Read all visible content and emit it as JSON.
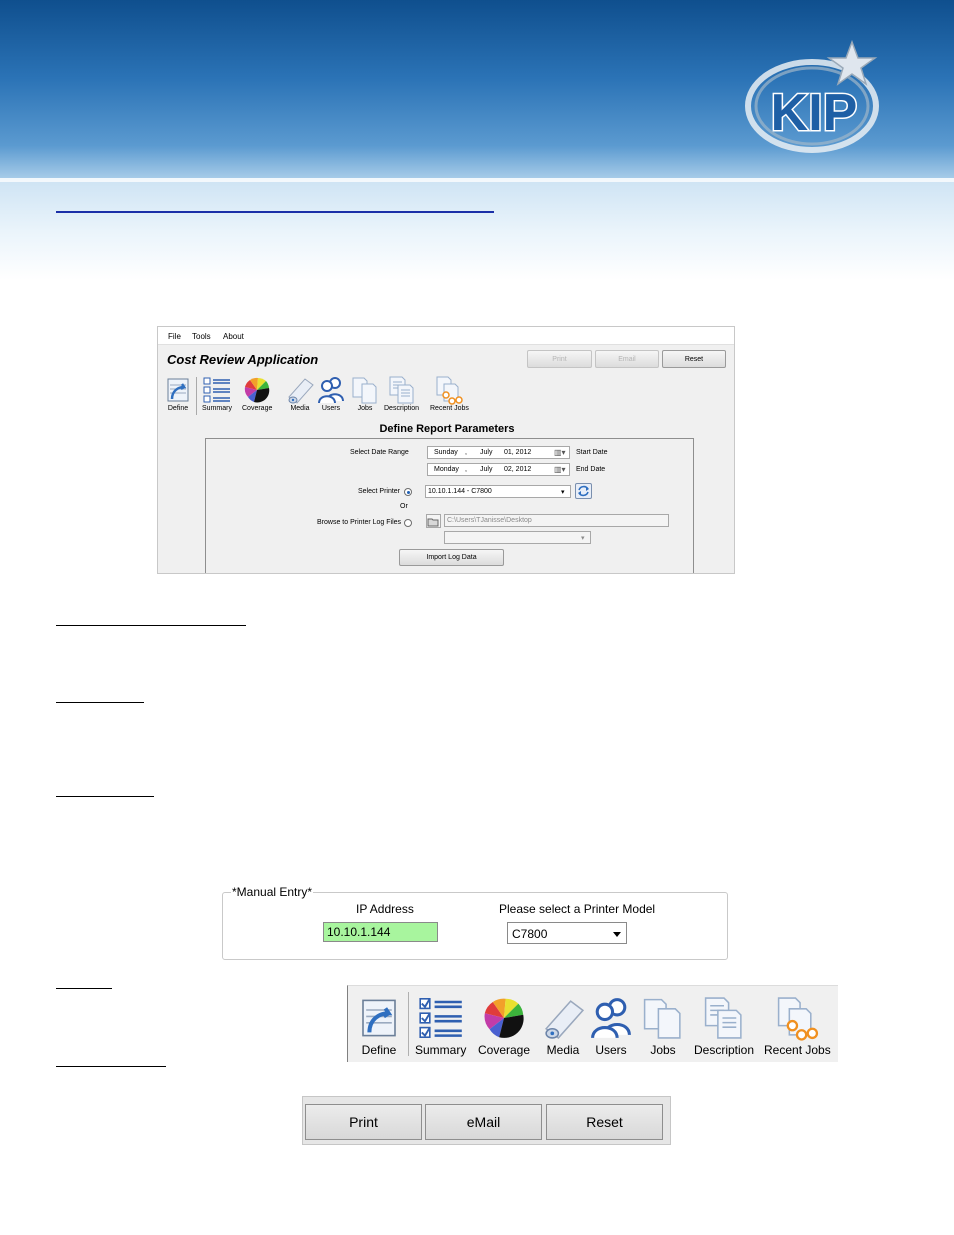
{
  "app_window": {
    "menu": [
      "File",
      "Tools",
      "About"
    ],
    "title": "Cost Review Application",
    "buttons": {
      "print": "Print",
      "email": "Email",
      "reset": "Reset"
    },
    "toolbar": [
      "Define",
      "Summary",
      "Coverage",
      "Media",
      "Users",
      "Jobs",
      "Description",
      "Recent Jobs"
    ],
    "section_title": "Define Report Parameters",
    "date_range": {
      "label": "Select Date Range",
      "start": {
        "day": "Sunday",
        "sep": ",",
        "month": "July",
        "date": "01, 2012",
        "label": "Start Date"
      },
      "end": {
        "day": "Monday",
        "sep": ",",
        "month": "July",
        "date": "02, 2012",
        "label": "End Date"
      }
    },
    "printer": {
      "label": "Select Printer",
      "value": "10.10.1.144  -  C7800",
      "selected": true
    },
    "or_label": "Or",
    "browse": {
      "label": "Browse to Printer Log Files",
      "path": "C:\\Users\\TJanisse\\Desktop",
      "selected": false
    },
    "import_button": "Import Log Data"
  },
  "manual_entry": {
    "legend": "*Manual Entry*",
    "ip_label": "IP Address",
    "ip_value": "10.10.1.144",
    "model_label": "Please select a Printer Model",
    "model_value": "C7800",
    "ip_field_color": "#a8f59e"
  },
  "big_toolbar": [
    "Define",
    "Summary",
    "Coverage",
    "Media",
    "Users",
    "Jobs",
    "Description",
    "Recent Jobs"
  ],
  "big_buttons": {
    "print": "Print",
    "email": "eMail",
    "reset": "Reset"
  },
  "logo": {
    "text": "KIP"
  },
  "colors": {
    "banner_dark": "#0f4f8e",
    "banner_light": "#a9cde9",
    "link_rule": "#1a2fa8",
    "icon_blue": "#2f5fb0"
  }
}
